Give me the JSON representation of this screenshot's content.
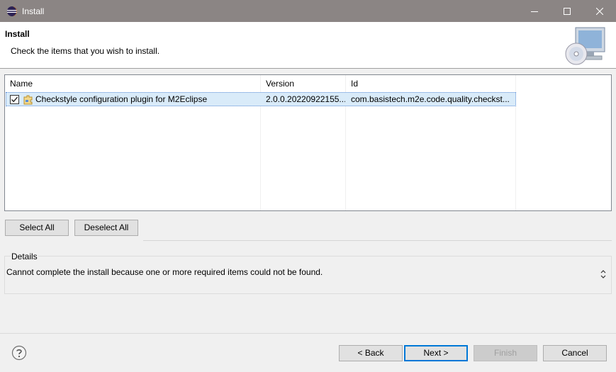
{
  "window": {
    "title": "Install",
    "app_icon": "eclipse-icon"
  },
  "header": {
    "title": "Install",
    "description": "Check the items that you wish to install.",
    "banner_icon": "install-computer-cd-icon"
  },
  "table": {
    "columns": [
      "Name",
      "Version",
      "Id"
    ],
    "rows": [
      {
        "checked": true,
        "name": "Checkstyle configuration plugin for M2Eclipse",
        "version": "2.0.0.20220922155...",
        "id": "com.basistech.m2e.code.quality.checkst..."
      }
    ]
  },
  "buttons": {
    "select_all": "Select All",
    "deselect_all": "Deselect All",
    "back": "< Back",
    "next": "Next >",
    "finish": "Finish",
    "cancel": "Cancel"
  },
  "details": {
    "label": "Details",
    "text": "Cannot complete the install because one or more required items could not be found."
  },
  "colors": {
    "titlebar": "#8b8584",
    "selection": "#d9ebf9",
    "accent": "#0078d7"
  }
}
